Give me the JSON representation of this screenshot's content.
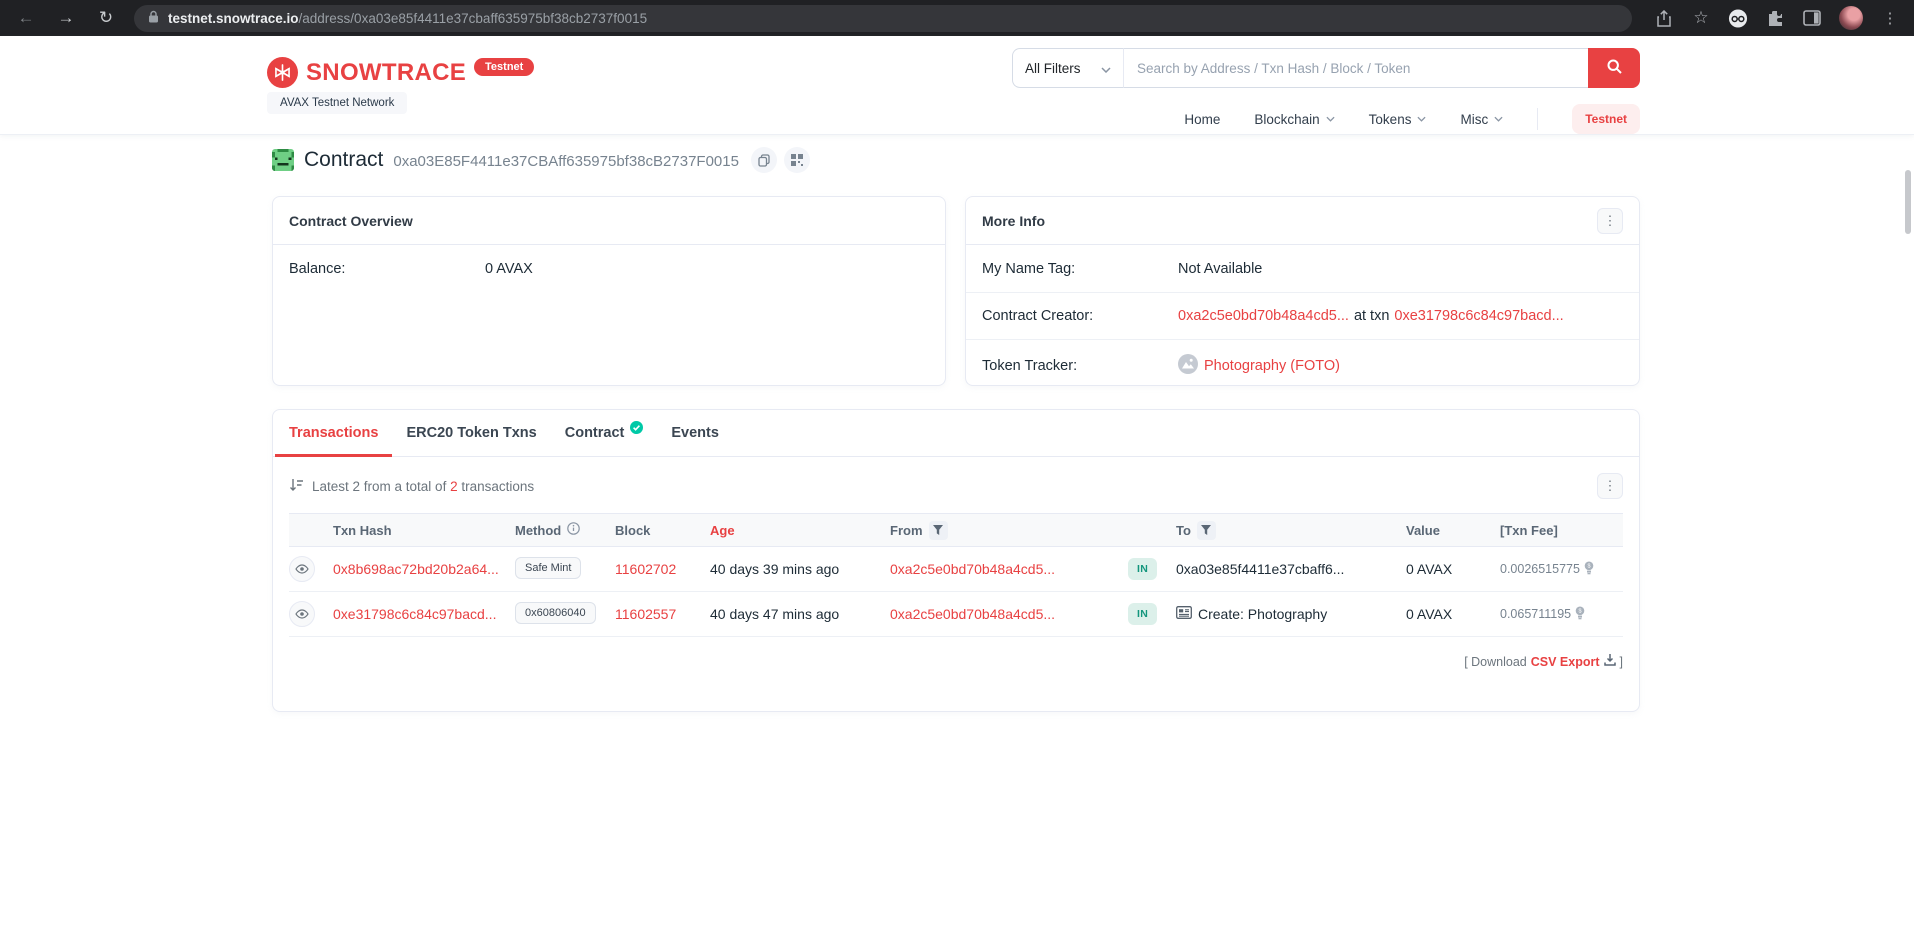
{
  "browser": {
    "url_domain": "testnet.snowtrace.io",
    "url_path": "/address/0xa03e85f4411e37cbaff635975bf38cb2737f0015"
  },
  "icons": {
    "back": "←",
    "forward": "→",
    "refresh": "↻",
    "star": "☆",
    "kebab": "⋮"
  },
  "header": {
    "logo_text": "SNOWTRACE",
    "logo_badge": "Testnet",
    "network_label": "AVAX Testnet Network",
    "search": {
      "filter_label": "All Filters",
      "placeholder": "Search by Address / Txn Hash / Block / Token"
    },
    "nav": {
      "home": "Home",
      "blockchain": "Blockchain",
      "tokens": "Tokens",
      "misc": "Misc",
      "testnet": "Testnet"
    }
  },
  "contract_header": {
    "type_label": "Contract",
    "address": "0xa03E85F4411e37CBAff635975bf38cB2737F0015"
  },
  "overview_card": {
    "title": "Contract Overview",
    "balance_label": "Balance:",
    "balance_value": "0 AVAX"
  },
  "more_info_card": {
    "title": "More Info",
    "name_tag_label": "My Name Tag:",
    "name_tag_value": "Not Available",
    "creator_label": "Contract Creator:",
    "creator_address": "0xa2c5e0bd70b48a4cd5...",
    "creator_middle": "at txn",
    "creator_txn": "0xe31798c6c84c97bacd...",
    "tracker_label": "Token Tracker:",
    "tracker_value": "Photography (FOTO)"
  },
  "tx_card": {
    "tabs": [
      "Transactions",
      "ERC20 Token Txns",
      "Contract",
      "Events"
    ],
    "summary_prefix": "Latest 2 from a total of",
    "summary_count": "2",
    "summary_suffix": "transactions",
    "headers": {
      "txn_hash": "Txn Hash",
      "method": "Method",
      "block": "Block",
      "age": "Age",
      "from": "From",
      "to": "To",
      "value": "Value",
      "txn_fee": "[Txn Fee]"
    },
    "rows": [
      {
        "hash": "0x8b698ac72bd20b2a64...",
        "method": "Safe Mint",
        "block": "11602702",
        "age": "40 days 39 mins ago",
        "from": "0xa2c5e0bd70b48a4cd5...",
        "direction": "IN",
        "to": "0xa03e85f4411e37cbaff6...",
        "value": "0 AVAX",
        "fee": "0.0026515775"
      },
      {
        "hash": "0xe31798c6c84c97bacd...",
        "method": "0x60806040",
        "block": "11602557",
        "age": "40 days 47 mins ago",
        "from": "0xa2c5e0bd70b48a4cd5...",
        "direction": "IN",
        "to": "Create: Photography",
        "value": "0 AVAX",
        "fee": "0.065711195"
      }
    ],
    "footer": {
      "open": "[ Download",
      "csv_label": "CSV Export",
      "close": "]"
    }
  },
  "colors": {
    "brand_red": "#e84142",
    "link_red": "#e84142",
    "in_badge_bg": "#dcf0ea",
    "in_badge_text": "#13967d",
    "border": "#e7eaf3"
  }
}
